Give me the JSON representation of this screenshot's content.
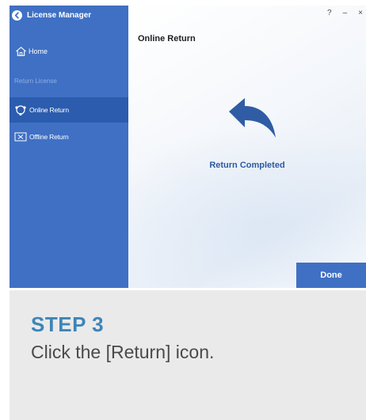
{
  "window": {
    "title": "License Manager",
    "controls": {
      "help": "?",
      "minimize": "–",
      "close": "×"
    }
  },
  "sidebar": {
    "home_label": "Home",
    "section_label": "Return License",
    "items": [
      {
        "label": "Online Return",
        "icon": "globe-icon",
        "selected": true
      },
      {
        "label": "Offline Return",
        "icon": "card-icon",
        "selected": false
      }
    ]
  },
  "main": {
    "heading": "Online Return",
    "icon": "return-arrow-icon",
    "status": "Return Completed",
    "done_label": "Done"
  },
  "caption": {
    "step": "STEP 3",
    "instruction": "Click the [Return] icon."
  },
  "colors": {
    "sidebar": "#3f70c4",
    "selected": "#2c5cae",
    "accent_text": "#2c5aa0",
    "step_title": "#3d85b8"
  }
}
